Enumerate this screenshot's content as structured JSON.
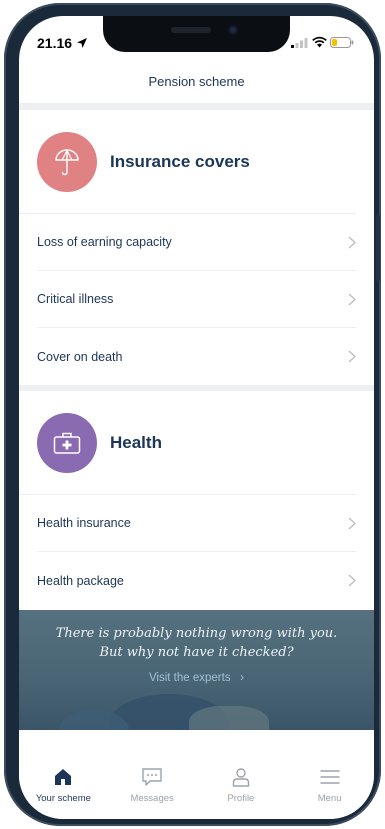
{
  "status_bar": {
    "time": "21.16"
  },
  "header": {
    "title": "Pension scheme"
  },
  "sections": [
    {
      "title": "Insurance covers",
      "icon": "umbrella-icon",
      "color": "#e08283",
      "items": [
        {
          "label": "Loss of earning capacity"
        },
        {
          "label": "Critical illness"
        },
        {
          "label": "Cover on death"
        }
      ]
    },
    {
      "title": "Health",
      "icon": "first-aid-kit-icon",
      "color": "#8a6bb1",
      "items": [
        {
          "label": "Health insurance"
        },
        {
          "label": "Health package"
        }
      ]
    }
  ],
  "banner": {
    "line1": "There is probably nothing wrong with you.",
    "line2": "But why not have it checked?",
    "link": "Visit the experts"
  },
  "tabs": [
    {
      "label": "Your scheme",
      "icon": "home-icon",
      "active": true
    },
    {
      "label": "Messages",
      "icon": "chat-icon",
      "active": false
    },
    {
      "label": "Profile",
      "icon": "person-icon",
      "active": false
    },
    {
      "label": "Menu",
      "icon": "hamburger-icon",
      "active": false
    }
  ],
  "colors": {
    "primary_text": "#1d3557",
    "inactive_tab": "#9aa3ad"
  }
}
